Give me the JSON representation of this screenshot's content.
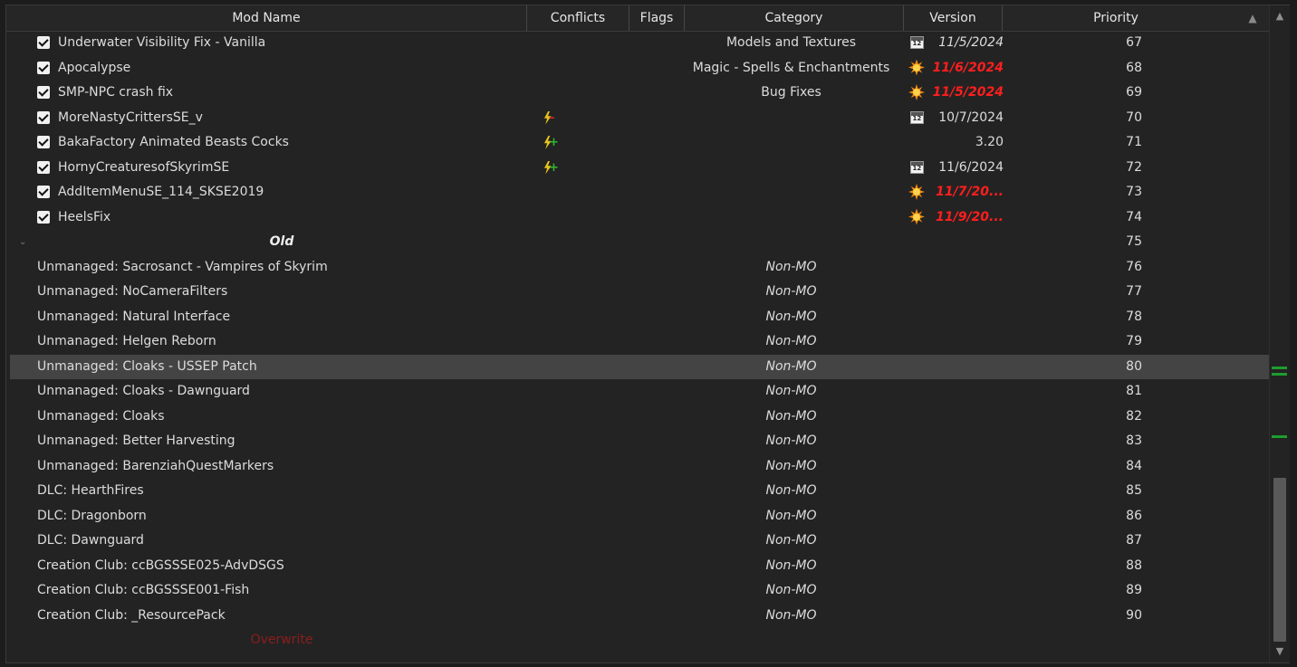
{
  "columns": {
    "mod_name": "Mod Name",
    "conflicts": "Conflicts",
    "flags": "Flags",
    "category": "Category",
    "version": "Version",
    "priority": "Priority"
  },
  "rows": [
    {
      "kind": "mod",
      "name": "Underwater Visibility Fix - Vanilla",
      "checked": true,
      "conflict_icon": "",
      "category": "Models and Textures",
      "version_icon": "calendar-icon",
      "version": "11/5/2024",
      "version_style": "italic",
      "priority": "67"
    },
    {
      "kind": "mod",
      "name": "Apocalypse",
      "checked": true,
      "conflict_icon": "",
      "category": "Magic - Spells & Enchantments",
      "version_icon": "update-sun-icon",
      "version": "11/6/2024",
      "version_style": "red",
      "priority": "68"
    },
    {
      "kind": "mod",
      "name": "SMP-NPC crash fix",
      "checked": true,
      "conflict_icon": "",
      "category": "Bug Fixes",
      "version_icon": "update-sun-icon",
      "version": "11/5/2024",
      "version_style": "red",
      "priority": "69"
    },
    {
      "kind": "mod",
      "name": "MoreNastyCrittersSE_v",
      "checked": true,
      "conflict_icon": "overwritten-conflict-icon",
      "category": "",
      "version_icon": "calendar-icon",
      "version": "10/7/2024",
      "version_style": "normal",
      "priority": "70"
    },
    {
      "kind": "mod",
      "name": "BakaFactory Animated Beasts Cocks",
      "checked": true,
      "conflict_icon": "overwrite-conflict-icon",
      "category": "",
      "version_icon": "",
      "version": "3.20",
      "version_style": "normal",
      "priority": "71"
    },
    {
      "kind": "mod",
      "name": "HornyCreaturesofSkyrimSE",
      "checked": true,
      "conflict_icon": "overwrite-conflict-icon",
      "category": "",
      "version_icon": "calendar-icon",
      "version": "11/6/2024",
      "version_style": "normal",
      "priority": "72"
    },
    {
      "kind": "mod",
      "name": "AddItemMenuSE_114_SKSE2019",
      "checked": true,
      "conflict_icon": "",
      "category": "",
      "version_icon": "update-sun-icon",
      "version": "11/7/20...",
      "version_style": "red",
      "priority": "73"
    },
    {
      "kind": "mod",
      "name": "HeelsFix",
      "checked": true,
      "conflict_icon": "",
      "category": "",
      "version_icon": "update-sun-icon",
      "version": "11/9/20...",
      "version_style": "red",
      "priority": "74"
    },
    {
      "kind": "separator",
      "name": "Old",
      "priority": "75"
    },
    {
      "kind": "unmanaged",
      "name": "Unmanaged: Sacrosanct - Vampires of Skyrim",
      "category": "Non-MO",
      "priority": "76"
    },
    {
      "kind": "unmanaged",
      "name": "Unmanaged: NoCameraFilters",
      "category": "Non-MO",
      "priority": "77"
    },
    {
      "kind": "unmanaged",
      "name": "Unmanaged: Natural Interface",
      "category": "Non-MO",
      "priority": "78"
    },
    {
      "kind": "unmanaged",
      "name": "Unmanaged: Helgen Reborn",
      "category": "Non-MO",
      "priority": "79"
    },
    {
      "kind": "unmanaged",
      "name": "Unmanaged: Cloaks - USSEP Patch",
      "category": "Non-MO",
      "priority": "80",
      "selected": true
    },
    {
      "kind": "unmanaged",
      "name": "Unmanaged: Cloaks - Dawnguard",
      "category": "Non-MO",
      "priority": "81"
    },
    {
      "kind": "unmanaged",
      "name": "Unmanaged: Cloaks",
      "category": "Non-MO",
      "priority": "82"
    },
    {
      "kind": "unmanaged",
      "name": "Unmanaged: Better Harvesting",
      "category": "Non-MO",
      "priority": "83"
    },
    {
      "kind": "unmanaged",
      "name": "Unmanaged: BarenziahQuestMarkers",
      "category": "Non-MO",
      "priority": "84"
    },
    {
      "kind": "unmanaged",
      "name": "DLC: HearthFires",
      "category": "Non-MO",
      "priority": "85"
    },
    {
      "kind": "unmanaged",
      "name": "DLC: Dragonborn",
      "category": "Non-MO",
      "priority": "86"
    },
    {
      "kind": "unmanaged",
      "name": "DLC: Dawnguard",
      "category": "Non-MO",
      "priority": "87"
    },
    {
      "kind": "unmanaged",
      "name": "Creation Club: ccBGSSSE025-AdvDSGS",
      "category": "Non-MO",
      "priority": "88"
    },
    {
      "kind": "unmanaged",
      "name": "Creation Club: ccBGSSSE001-Fish",
      "category": "Non-MO",
      "priority": "89"
    },
    {
      "kind": "unmanaged",
      "name": "Creation Club: _ResourcePack",
      "category": "Non-MO",
      "priority": "90"
    },
    {
      "kind": "overwrite",
      "name": "Overwrite",
      "priority": ""
    }
  ],
  "colors": {
    "background": "#232323",
    "selected_row": "#444444",
    "update_red": "#ff1e1e",
    "overwrite_red": "#8c1d1d",
    "scroll_marker_green": "#1e9c2e"
  }
}
